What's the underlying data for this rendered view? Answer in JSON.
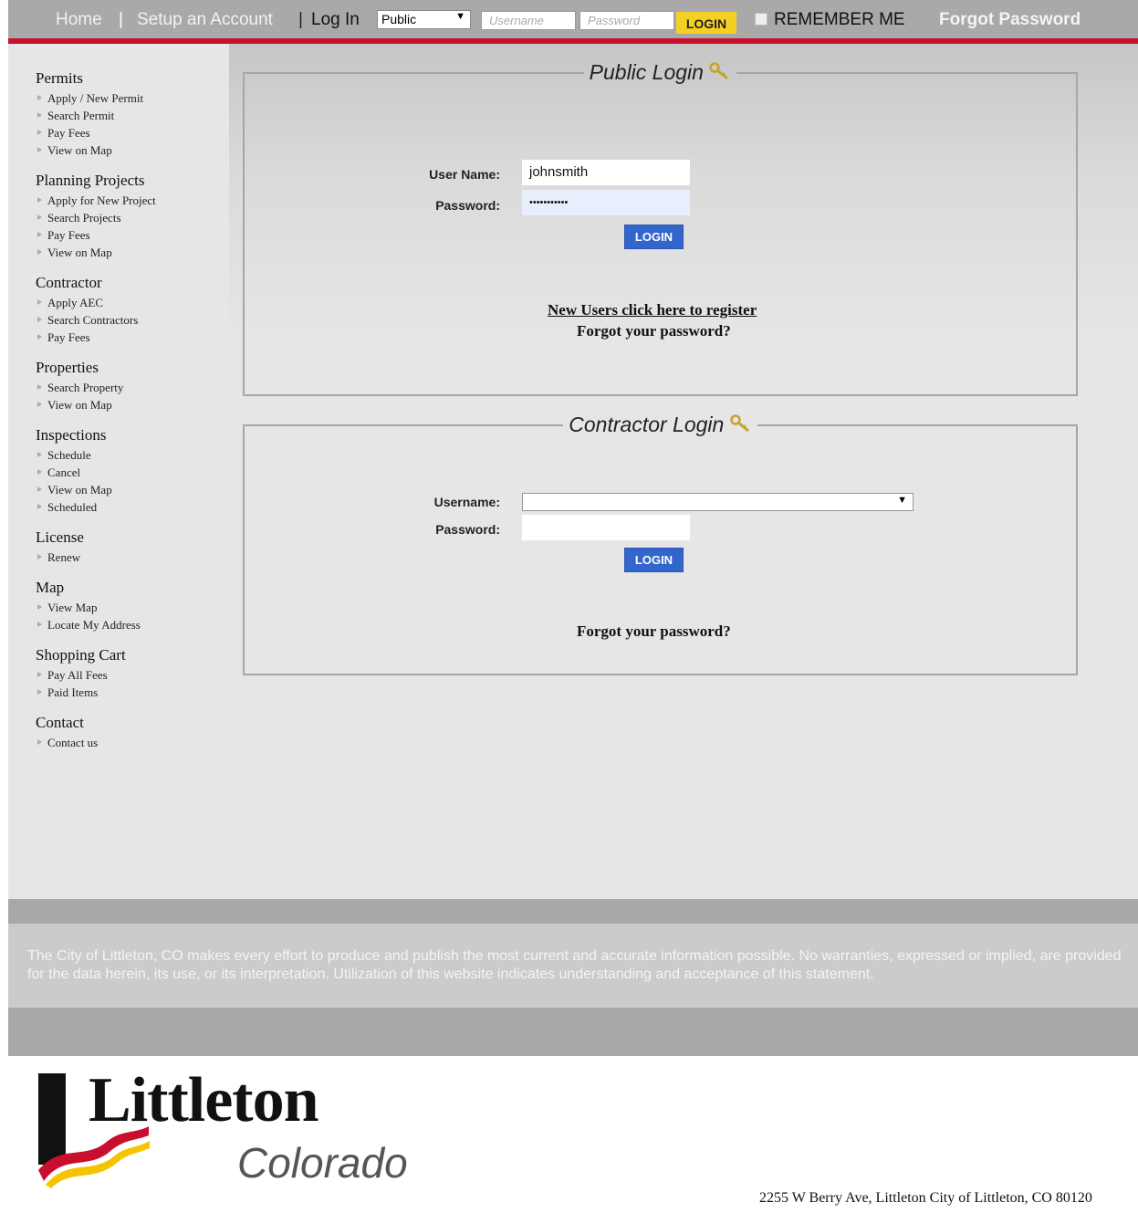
{
  "topbar": {
    "home": "Home",
    "setup": "Setup an Account",
    "login_label": "Log In",
    "account_type": "Public",
    "username_placeholder": "Username",
    "password_placeholder": "Password",
    "login_button": "LOGIN",
    "remember_me": "REMEMBER ME",
    "forgot_password": "Forgot Password"
  },
  "sidebar": [
    {
      "heading": "Permits",
      "items": [
        "Apply / New Permit",
        "Search Permit",
        "Pay Fees",
        "View on Map"
      ]
    },
    {
      "heading": "Planning Projects",
      "items": [
        "Apply for New Project",
        "Search Projects",
        "Pay Fees",
        "View on Map"
      ]
    },
    {
      "heading": "Contractor",
      "items": [
        "Apply AEC",
        "Search Contractors",
        "Pay Fees"
      ]
    },
    {
      "heading": "Properties",
      "items": [
        "Search Property",
        "View on Map"
      ]
    },
    {
      "heading": "Inspections",
      "items": [
        "Schedule",
        "Cancel",
        "View on Map",
        "Scheduled"
      ]
    },
    {
      "heading": "License",
      "items": [
        "Renew"
      ]
    },
    {
      "heading": "Map",
      "items": [
        "View Map",
        "Locate My Address"
      ]
    },
    {
      "heading": "Shopping Cart",
      "items": [
        "Pay All Fees",
        "Paid Items"
      ]
    },
    {
      "heading": "Contact",
      "items": [
        "Contact us"
      ]
    }
  ],
  "public_login": {
    "title": "Public Login",
    "username_label": "User Name:",
    "username_value": "johnsmith",
    "password_label": "Password:",
    "password_value": "•••••••••••",
    "login_button": "LOGIN",
    "register_link": "New Users click here to register",
    "forgot_link": "Forgot your password?"
  },
  "contractor_login": {
    "title": "Contractor Login",
    "username_label": "Username:",
    "password_label": "Password:",
    "login_button": "LOGIN",
    "forgot_link": "Forgot your password?"
  },
  "footer": {
    "disclaimer": "The City of Littleton, CO makes every effort to produce and publish the most current and accurate information possible. No warranties, expressed or implied, are provided for the data herein, its use, or its interpretation. Utilization of this website indicates understanding and acceptance of this statement.",
    "logo_name": "Littleton",
    "logo_state": "Colorado",
    "address": "2255 W Berry Ave, Littleton City of Littleton, CO 80120"
  },
  "colors": {
    "accent_red": "#c8102e",
    "button_blue": "#3366cc",
    "login_yellow": "#f5d024"
  },
  "icons": [
    "key-icon",
    "dropdown-arrow-icon",
    "bullet-arrow-icon",
    "littleton-logo-mark"
  ]
}
